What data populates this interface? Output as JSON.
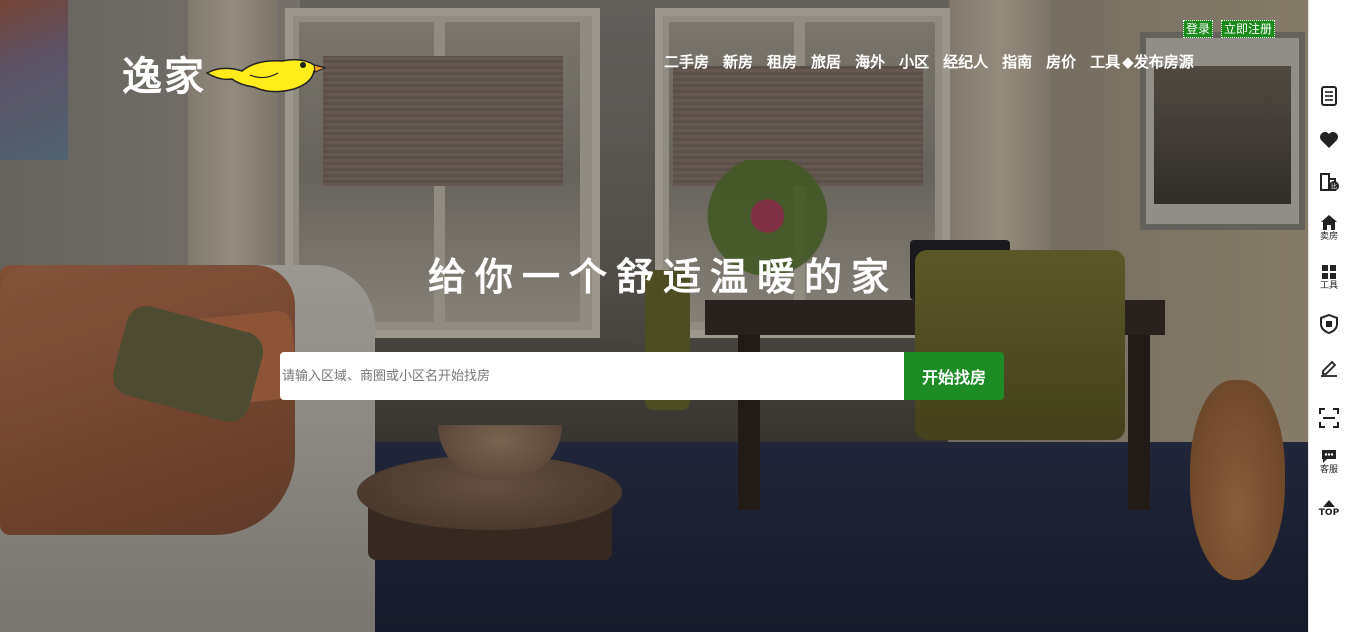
{
  "header": {
    "logo_text": "逸家",
    "nav": [
      "二手房",
      "新房",
      "租房",
      "旅居",
      "海外",
      "小区",
      "经纪人",
      "指南",
      "房价",
      "工具",
      "◆发布房源"
    ],
    "login": "登录",
    "register": "立即注册"
  },
  "hero": {
    "title": "给你一个舒适温暖的家",
    "search_placeholder": "请输入区域、商圈或小区名开始找房",
    "search_button": "开始找房"
  },
  "rightbar": {
    "items": [
      {
        "icon": "list-icon",
        "label": ""
      },
      {
        "icon": "heart-icon",
        "label": ""
      },
      {
        "icon": "building-compare-icon",
        "label": ""
      },
      {
        "icon": "house-sell-icon",
        "label": "卖房"
      },
      {
        "icon": "grid-tools-icon",
        "label": "工具"
      },
      {
        "icon": "shield-icon",
        "label": ""
      },
      {
        "icon": "pen-icon",
        "label": ""
      },
      {
        "icon": "scan-icon",
        "label": ""
      },
      {
        "icon": "chat-icon",
        "label": "客服"
      },
      {
        "icon": "arrow-up-icon",
        "label": "TOP"
      }
    ]
  },
  "colors": {
    "accent_green": "#1e8c24",
    "text_white": "#ffffff"
  }
}
